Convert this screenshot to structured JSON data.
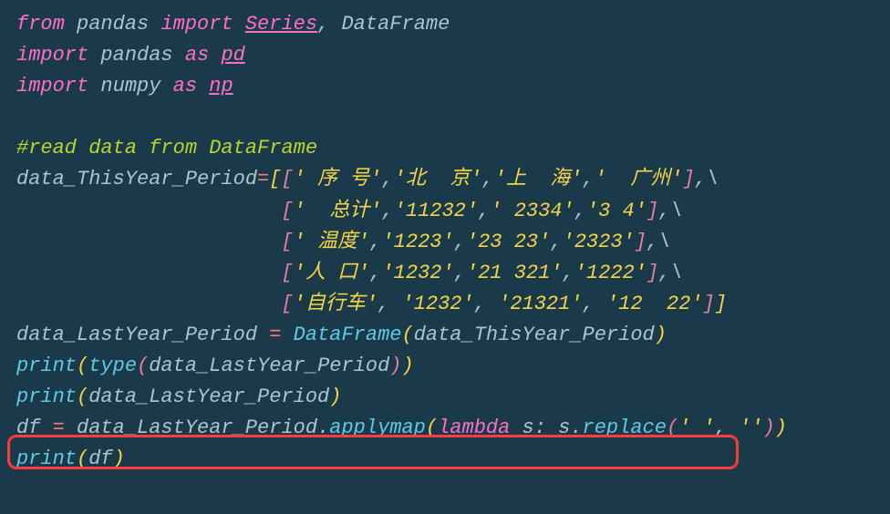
{
  "code": {
    "line1": {
      "from": "from",
      "module": "pandas",
      "import": "import",
      "name1": "Series",
      "comma": ",",
      "name2": "DataFrame"
    },
    "line2": {
      "import": "import",
      "module": "pandas",
      "as": "as",
      "alias": "pd"
    },
    "line3": {
      "import": "import",
      "module": "numpy",
      "as": "as",
      "alias": "np"
    },
    "line5": {
      "comment": "#read data from DataFrame"
    },
    "line6": {
      "var": "data_ThisYear_Period",
      "eq": "=",
      "r1": "[[",
      "s1": "' 序 号'",
      "c1": ",",
      "s2": "'北  京'",
      "c2": ",",
      "s3": "'上  海'",
      "c3": ",",
      "s4": "'  广州'",
      "r2": "]",
      "c4": ",",
      "bs": "\\"
    },
    "line7": {
      "indent": "                      ",
      "r1": "[",
      "s1": "'  总计'",
      "c1": ",",
      "s2": "'11232'",
      "c2": ",",
      "s3": "' 2334'",
      "c3": ",",
      "s4": "'3 4'",
      "r2": "]",
      "c4": ",",
      "bs": "\\"
    },
    "line8": {
      "indent": "                      ",
      "r1": "[",
      "s1": "' 温度'",
      "c1": ",",
      "s2": "'1223'",
      "c2": ",",
      "s3": "'23 23'",
      "c3": ",",
      "s4": "'2323'",
      "r2": "]",
      "c4": ",",
      "bs": "\\"
    },
    "line9": {
      "indent": "                      ",
      "r1": "[",
      "s1": "'人 口'",
      "c1": ",",
      "s2": "'1232'",
      "c2": ",",
      "s3": "'21 321'",
      "c3": ",",
      "s4": "'1222'",
      "r2": "]",
      "c4": ",",
      "bs": "\\"
    },
    "line10": {
      "indent": "                      ",
      "r1": "[",
      "s1": "'自行车'",
      "c1": ",",
      "sp1": " ",
      "s2": "'1232'",
      "c2": ",",
      "sp2": " ",
      "s3": "'21321'",
      "c3": ",",
      "sp3": " ",
      "s4": "'12  22'",
      "r2": "]]"
    },
    "line11": {
      "var": "data_LastYear_Period",
      "sp1": " ",
      "eq": "=",
      "sp2": " ",
      "cls": "DataFrame",
      "p1": "(",
      "arg": "data_ThisYear_Period",
      "p2": ")"
    },
    "line12": {
      "fn": "print",
      "p1": "(",
      "tfn": "type",
      "p2": "(",
      "arg": "data_LastYear_Period",
      "p3": ")",
      "p4": ")"
    },
    "line13": {
      "fn": "print",
      "p1": "(",
      "arg": "data_LastYear_Period",
      "p2": ")"
    },
    "line14": {
      "var": "df",
      "sp1": " ",
      "eq": "=",
      "sp2": " ",
      "obj": "data_LastYear_Period",
      "dot": ".",
      "method": "applymap",
      "p1": "(",
      "lambda": "lambda",
      "sp3": " ",
      "param": "s",
      "colon": ":",
      "sp4": " ",
      "s": "s",
      "dot2": ".",
      "rep": "replace",
      "p2": "(",
      "str1": "' '",
      "c1": ",",
      "sp5": " ",
      "str2": "''",
      "p3": ")",
      "p4": ")"
    },
    "line15": {
      "fn": "print",
      "p1": "(",
      "arg": "df",
      "p2": ")"
    }
  }
}
